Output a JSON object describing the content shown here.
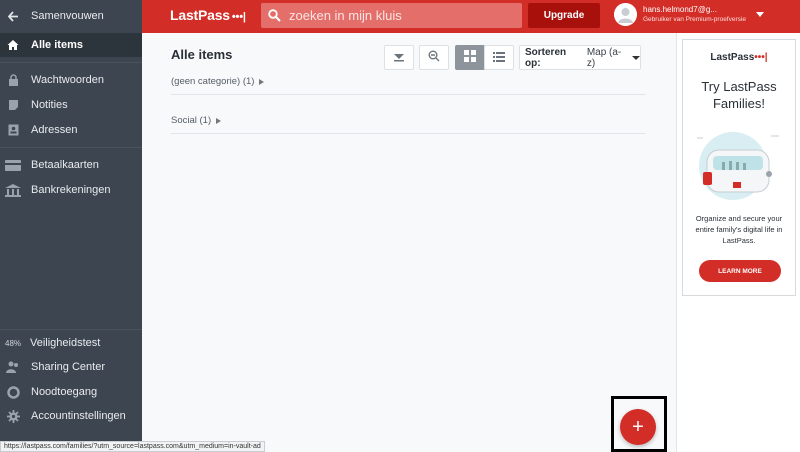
{
  "sidebar": {
    "collapse_label": "Samenvouwen",
    "items": [
      {
        "label": "Alle items",
        "icon": "home-icon"
      },
      {
        "label": "Wachtwoorden",
        "icon": "lock-icon"
      },
      {
        "label": "Notities",
        "icon": "note-icon"
      },
      {
        "label": "Adressen",
        "icon": "address-card-icon"
      },
      {
        "label": "Betaalkaarten",
        "icon": "credit-card-icon"
      },
      {
        "label": "Bankrekeningen",
        "icon": "bank-icon"
      }
    ],
    "bottom_items": [
      {
        "label": "Veiligheidstest",
        "badge": "48%"
      },
      {
        "label": "Sharing Center",
        "icon": "users-icon"
      },
      {
        "label": "Noodtoegang",
        "icon": "lifebuoy-icon"
      },
      {
        "label": "Accountinstellingen",
        "icon": "gear-icon"
      }
    ]
  },
  "topbar": {
    "logo": "LastPass",
    "logo_dots": "•••|",
    "search_placeholder": "zoeken in mijn kluis",
    "upgrade_label": "Upgrade",
    "user_name": "hans.helmond7@g...",
    "user_sub": "Gebruiker van Premium-proefversie"
  },
  "main": {
    "title": "Alle items",
    "sort_label": "Sorteren op:",
    "sort_value": "Map (a-z)",
    "categories": [
      {
        "label": "(geen categorie) (1)"
      },
      {
        "label": "Social (1)"
      }
    ],
    "fab_label": "+"
  },
  "ad": {
    "logo": "LastPass",
    "logo_dots": "•••|",
    "title": "Try LastPass Families!",
    "text": "Organize and secure your entire family's digital life in LastPass.",
    "button": "LEARN MORE"
  },
  "status_url": "https://lastpass.com/families/?utm_source=lastpass.com&utm_medium=in-vault-ad",
  "colors": {
    "brand_red": "#d32d27",
    "sidebar": "#3d4650",
    "upgrade": "#a8100c"
  }
}
